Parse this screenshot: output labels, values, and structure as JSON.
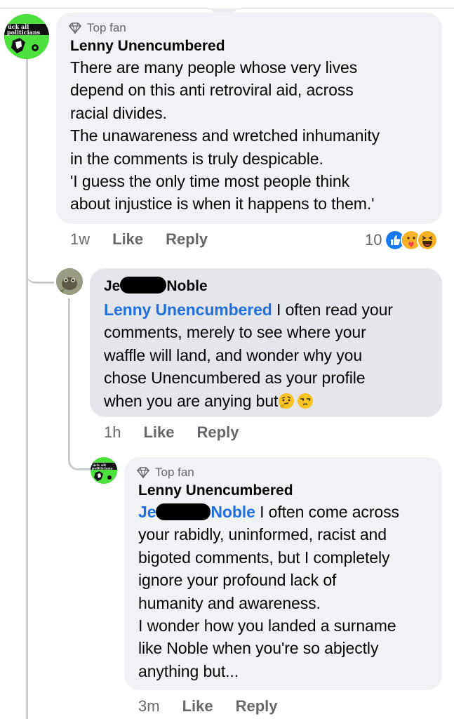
{
  "comment1": {
    "badge": "Top fan",
    "author": "Lenny Unencumbered",
    "text": "There are many people whose very lives\ndepend on this anti retroviral aid, across\nracial divides.\nThe unawareness and wretched inhumanity\nin the comments is truly despicable.\n'I guess the only time most people think\nabout injustice is when it happens to them.'",
    "time": "1w",
    "like_label": "Like",
    "reply_label": "Reply",
    "reaction_count": "10",
    "reactions": [
      "like-icon",
      "care-icon",
      "haha-icon"
    ]
  },
  "comment2": {
    "author_first": "Je",
    "author_last": "Noble",
    "mention": "Lenny Unencumbered",
    "text_line1_rest": " I often read your",
    "text_rest": "comments, merely to see where your\nwaffle will land, and wonder why you\nchose Unencumbered as your profile\nwhen you are anying but",
    "trailing_emojis": [
      "thinking-face-icon",
      "unamused-face-icon"
    ],
    "time": "1h",
    "like_label": "Like",
    "reply_label": "Reply"
  },
  "comment3": {
    "badge": "Top fan",
    "author": "Lenny Unencumbered",
    "mention_first": "Je",
    "mention_last": "Noble",
    "text_line1_rest": " I often come across",
    "text_rest": "your rabidly, uninformed, racist and\nbigoted comments, but I completely\nignore your profound lack of\nhumanity and awareness.\nI wonder how you landed a surname\nlike Noble when you're so abjectly\nanything but...",
    "time": "3m",
    "like_label": "Like",
    "reply_label": "Reply"
  },
  "colors": {
    "bubble": "#f0f2f5",
    "bubble_highlight": "#e4e6eb",
    "mention": "#216fdb",
    "meta": "#65676b",
    "text": "#050505",
    "avatar_green": "#4ce13c"
  }
}
